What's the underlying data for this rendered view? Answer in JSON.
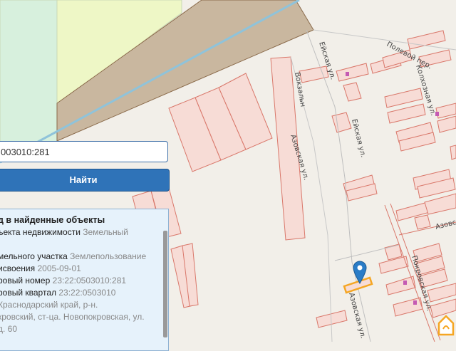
{
  "map": {
    "streets": {
      "eiskaya_1": "Ейская ул.",
      "eiskaya_2": "Ейская ул.",
      "azovskaya_1": "Азовская ул.",
      "azovskaya_2": "Азовская ул.",
      "azovskaya_3": "Азовс",
      "vokzalnaya": "Вокзальн",
      "polevoy": "Полевой пер.",
      "kolkhoznaya": "Колхозная ул.",
      "pokrovskaya": "Покровская ул."
    },
    "colors": {
      "background": "#f2efe9",
      "parcel_fill": "#f7dcd6",
      "parcel_stroke": "#d9776a",
      "selected_parcel": "#f5a623",
      "marker": "#2a7cc7",
      "brown_area": "#c9b79f",
      "green_area": "#d7f0dd",
      "yellow_area": "#eef7c6",
      "road": "#8fc3da"
    },
    "icons": [
      "location-marker-icon",
      "home-icon"
    ]
  },
  "search": {
    "value": "003010:281",
    "button_label": "Найти"
  },
  "result": {
    "title": "д в найденные объекты",
    "rows": [
      {
        "label": "ъекта недвижимости",
        "value": "Земельный"
      },
      {
        "label": "",
        "value": ""
      },
      {
        "label": "мельного участка",
        "value": "Землепользование"
      },
      {
        "label": "исвоения",
        "value": "2005-09-01"
      },
      {
        "label": "ровый номер",
        "value": "23:22:0503010:281"
      },
      {
        "label": "ровый квартал",
        "value": "23:22:0503010"
      },
      {
        "label": "Краснодарский край, р-н.",
        "value": ""
      },
      {
        "label": "кровский, ст-ца. Новопокровская, ул.",
        "value": ""
      },
      {
        "label": "д. 60",
        "value": ""
      }
    ]
  }
}
